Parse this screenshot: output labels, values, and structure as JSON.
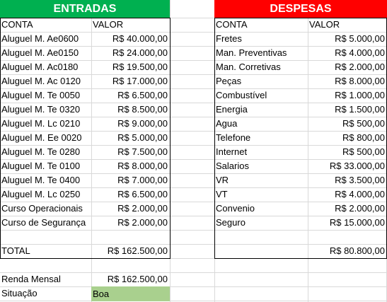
{
  "entradas": {
    "title": "ENTRADAS",
    "col_conta": "CONTA",
    "col_valor": "VALOR",
    "rows": [
      {
        "conta": "Aluguel M. Ae0600",
        "valor": "R$ 40.000,00"
      },
      {
        "conta": "Aluguel M. Ae0150",
        "valor": "R$ 24.000,00"
      },
      {
        "conta": "Aluguel M. Ac0180",
        "valor": "R$ 19.500,00"
      },
      {
        "conta": "Aluguel M. Ac 0120",
        "valor": "R$ 17.000,00"
      },
      {
        "conta": "Aluguel M. Te 0050",
        "valor": "R$ 6.500,00"
      },
      {
        "conta": "Aluguel M. Te 0320",
        "valor": "R$ 8.500,00"
      },
      {
        "conta": "Aluguel M. Lc 0210",
        "valor": "R$ 9.000,00"
      },
      {
        "conta": "Aluguel M. Ee 0020",
        "valor": "R$ 5.000,00"
      },
      {
        "conta": "Aluguel M. Te 0280",
        "valor": "R$ 7.500,00"
      },
      {
        "conta": "Aluguel M. Te 0100",
        "valor": "R$ 8.000,00"
      },
      {
        "conta": "Aluguel M. Te 0400",
        "valor": "R$ 7.000,00"
      },
      {
        "conta": "Aluguel M. Lc 0250",
        "valor": "R$ 6.500,00"
      },
      {
        "conta": "Curso Operacionais",
        "valor": "R$ 2.000,00"
      },
      {
        "conta": "Curso de Segurança",
        "valor": "R$ 2.000,00"
      }
    ],
    "total_label": "TOTAL",
    "total_value": "R$ 162.500,00"
  },
  "despesas": {
    "title": "DESPESAS",
    "col_conta": "CONTA",
    "col_valor": "VALOR",
    "rows": [
      {
        "conta": "Fretes",
        "valor": "R$ 5.000,00"
      },
      {
        "conta": "Man. Preventivas",
        "valor": "R$ 4.000,00"
      },
      {
        "conta": "Man. Corretivas",
        "valor": "R$ 2.000,00"
      },
      {
        "conta": "Peças",
        "valor": "R$ 8.000,00"
      },
      {
        "conta": "Combustível",
        "valor": "R$ 1.000,00"
      },
      {
        "conta": "Energia",
        "valor": "R$ 1.500,00"
      },
      {
        "conta": "Agua",
        "valor": "R$ 500,00"
      },
      {
        "conta": "Telefone",
        "valor": "R$ 800,00"
      },
      {
        "conta": "Internet",
        "valor": "R$ 500,00"
      },
      {
        "conta": "Salarios",
        "valor": "R$ 33.000,00"
      },
      {
        "conta": "VR",
        "valor": "R$ 3.500,00"
      },
      {
        "conta": "VT",
        "valor": "R$ 4.000,00"
      },
      {
        "conta": "Convenio",
        "valor": "R$ 2.000,00"
      },
      {
        "conta": "Seguro",
        "valor": "R$ 15.000,00"
      }
    ],
    "total_value": "R$ 80.800,00"
  },
  "resumo": {
    "renda_label": "Renda Mensal",
    "renda_value": "R$ 162.500,00",
    "situacao_label": "Situação",
    "situacao_value": "Boa"
  },
  "colors": {
    "entradas_header": "#00b050",
    "despesas_header": "#ff0000",
    "situacao_fill": "#a9d08e"
  }
}
